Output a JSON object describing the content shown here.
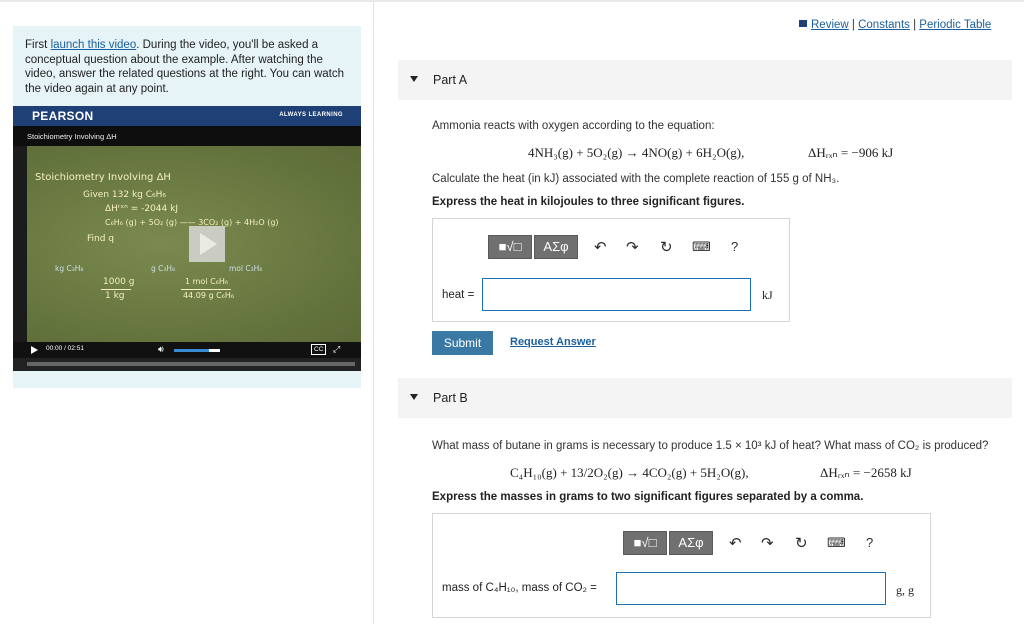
{
  "intro": {
    "t1": "First ",
    "link": "launch this video",
    "t2": ". During the video, you'll be asked a conceptual question about the example. After watching the video, answer the related questions at the right. You can watch the video again at any point."
  },
  "video": {
    "brand": "PEARSON",
    "tagline": "ALWAYS LEARNING",
    "subtitle": "Stoichiometry Involving ΔH",
    "board": {
      "title": "Stoichiometry Involving ΔH",
      "given": "Given 132 kg C₆H₆",
      "dh": "ΔHʳˣⁿ = -2044 kJ",
      "reaction": "C₆H₆ (g) + 5O₂ (g) —— 3CO₂ (g) + 4H₂O (g)",
      "find": "Find q",
      "box1": "kg C₃H₈",
      "box2": "g C₃H₈",
      "box3": "mol C₃H₈",
      "f1_num": "1000 g",
      "f1_den": "1 kg",
      "f2_num": "1 mol C₆H₆",
      "f2_den": "44.09 g C₆H₆"
    },
    "time": "00:00 / 02:51",
    "volume": 0.75,
    "cc": "CC"
  },
  "links": {
    "review": "Review",
    "sep": " | ",
    "constants": "Constants",
    "periodic": "Periodic Table"
  },
  "partA": {
    "title": "Part A",
    "intro": "Ammonia reacts with oxygen according to the equation:",
    "eq_lhs": "4NH₃(g) + 5O₂(g) → 4NO(g) + 6H₂O(g),",
    "eq_rhs": "ΔHᵣₓₙ = −906 kJ",
    "calc": "Calculate the heat (in kJ) associated with the complete reaction of 155 g of NH₃.",
    "express": "Express the heat in kilojoules to three significant figures.",
    "label": "heat =",
    "unit": "kJ",
    "submit": "Submit",
    "request": "Request Answer"
  },
  "partB": {
    "title": "Part B",
    "question": "What mass of butane in grams is necessary to produce 1.5 × 10³ kJ of heat? What mass of CO₂ is produced?",
    "eq_lhs": "C₄H₁₀(g) + 13/2O₂(g) → 4CO₂(g) + 5H₂O(g),",
    "eq_rhs": "ΔHᵣₓₙ = −2658 kJ",
    "express": "Express the masses in grams to two significant figures separated by a comma.",
    "label": "mass of C₄H₁₀, mass of CO₂ =",
    "unit": "g, g"
  },
  "toolbar": {
    "template": "■√□",
    "greek": "AΣφ",
    "help": "?"
  }
}
